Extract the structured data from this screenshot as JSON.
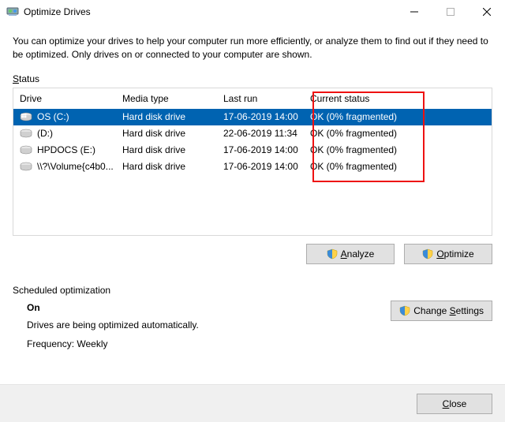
{
  "window": {
    "title": "Optimize Drives"
  },
  "intro": "You can optimize your drives to help your computer run more efficiently, or analyze them to find out if they need to be optimized. Only drives on or connected to your computer are shown.",
  "status_label_prefix": "S",
  "status_label_rest": "tatus",
  "columns": {
    "drive": "Drive",
    "media": "Media type",
    "last": "Last run",
    "status": "Current status"
  },
  "drives": [
    {
      "name": "OS (C:)",
      "media": "Hard disk drive",
      "last": "17-06-2019 14:00",
      "status": "OK (0% fragmented)",
      "selected": true,
      "icon": "win"
    },
    {
      "name": "(D:)",
      "media": "Hard disk drive",
      "last": "22-06-2019 11:34",
      "status": "OK (0% fragmented)",
      "selected": false,
      "icon": "hdd"
    },
    {
      "name": "HPDOCS (E:)",
      "media": "Hard disk drive",
      "last": "17-06-2019 14:00",
      "status": "OK (0% fragmented)",
      "selected": false,
      "icon": "hdd"
    },
    {
      "name": "\\\\?\\Volume{c4b0...",
      "media": "Hard disk drive",
      "last": "17-06-2019 14:00",
      "status": "OK (0% fragmented)",
      "selected": false,
      "icon": "hdd"
    }
  ],
  "buttons": {
    "analyze_u": "A",
    "analyze_rest": "nalyze",
    "optimize_u": "O",
    "optimize_rest": "ptimize",
    "change_u": "S",
    "change_pre": "Change ",
    "change_post": "ettings",
    "close_u": "C",
    "close_rest": "lose"
  },
  "scheduled": {
    "heading": "Scheduled optimization",
    "state": "On",
    "desc": "Drives are being optimized automatically.",
    "freq_label": "Frequency:",
    "freq_value": "Weekly"
  }
}
